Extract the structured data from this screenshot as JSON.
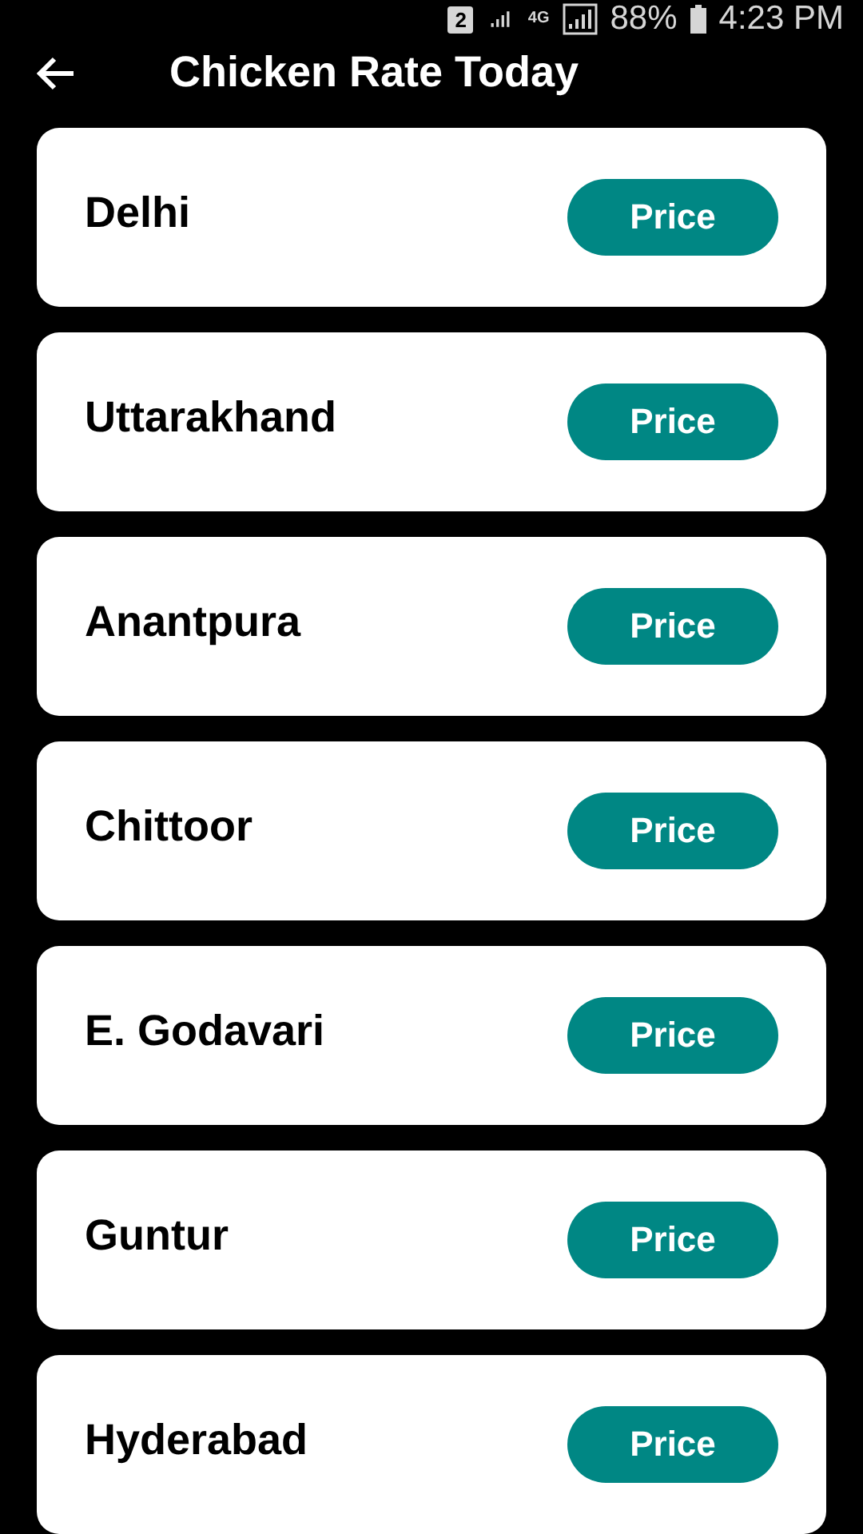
{
  "status_bar": {
    "sim": "2",
    "network": "4G",
    "battery": "88%",
    "time": "4:23 PM"
  },
  "app_bar": {
    "title": "Chicken Rate Today"
  },
  "cities": [
    {
      "name": "Delhi",
      "button": "Price"
    },
    {
      "name": "Uttarakhand",
      "button": "Price"
    },
    {
      "name": "Anantpura",
      "button": "Price"
    },
    {
      "name": "Chittoor",
      "button": "Price"
    },
    {
      "name": "E. Godavari",
      "button": "Price"
    },
    {
      "name": "Guntur",
      "button": "Price"
    },
    {
      "name": "Hyderabad",
      "button": "Price"
    }
  ]
}
